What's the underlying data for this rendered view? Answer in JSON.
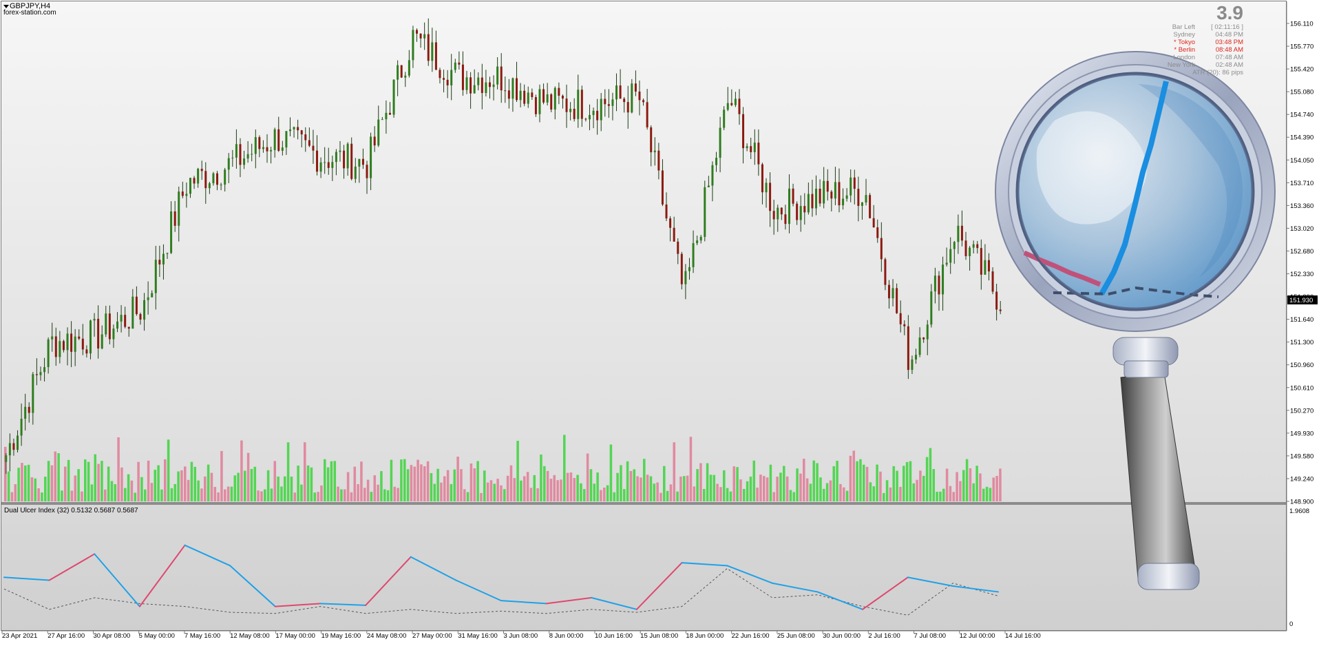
{
  "header": {
    "symbol": "GBPJPY,H4",
    "site": "forex-station.com"
  },
  "info_panel": {
    "spread": "3.9",
    "rows": [
      {
        "label": "Bar Left",
        "value": "[ 02:11:16 ]",
        "highlight": false
      },
      {
        "label": "Sydney",
        "value": "04:48 PM",
        "highlight": false
      },
      {
        "label": "* Tokyo",
        "value": "03:48 PM",
        "highlight": true
      },
      {
        "label": "* Berlin",
        "value": "08:48 AM",
        "highlight": true
      },
      {
        "label": "London",
        "value": "07:48 AM",
        "highlight": false
      },
      {
        "label": "New York",
        "value": "02:48 AM",
        "highlight": false
      }
    ],
    "atr": "ATR (20): 86 pips"
  },
  "price_axis": {
    "labels": [
      "156.110",
      "155.770",
      "155.420",
      "155.080",
      "154.740",
      "154.390",
      "154.050",
      "153.710",
      "153.360",
      "153.020",
      "152.680",
      "152.330",
      "151.990",
      "151.640",
      "151.300",
      "150.960",
      "150.610",
      "150.270",
      "149.930",
      "149.580",
      "149.240",
      "148.900"
    ],
    "current_price": "151.930"
  },
  "indicator": {
    "label": "Dual Ulcer Index (32) 0.5132 0.5687 0.5687",
    "axis_top": "1.9608",
    "axis_bottom": "0"
  },
  "time_axis": {
    "labels": [
      "23 Apr 2021",
      "27 Apr 16:00",
      "30 Apr 08:00",
      "5 May 00:00",
      "7 May 16:00",
      "12 May 08:00",
      "17 May 00:00",
      "19 May 16:00",
      "24 May 08:00",
      "27 May 00:00",
      "31 May 16:00",
      "3 Jun 08:00",
      "8 Jun 00:00",
      "10 Jun 16:00",
      "15 Jun 08:00",
      "18 Jun 00:00",
      "22 Jun 16:00",
      "25 Jun 08:00",
      "30 Jun 00:00",
      "2 Jul 16:00",
      "7 Jul 08:00",
      "12 Jul 00:00",
      "14 Jul 16:00"
    ]
  },
  "chart_data": [
    {
      "type": "candlestick",
      "title": "GBPJPY,H4",
      "ylim": [
        148.9,
        156.11
      ],
      "up_color": "#2e7d1e",
      "down_color": "#8b1a10",
      "key_closes": [
        [
          "23 Apr 2021",
          149.6
        ],
        [
          "27 Apr 16:00",
          151.3
        ],
        [
          "30 Apr 08:00",
          151.4
        ],
        [
          "5 May 00:00",
          151.8
        ],
        [
          "7 May 16:00",
          153.7
        ],
        [
          "12 May 08:00",
          154.0
        ],
        [
          "17 May 00:00",
          154.4
        ],
        [
          "19 May 16:00",
          154.1
        ],
        [
          "24 May 08:00",
          154.0
        ],
        [
          "27 May 00:00",
          155.9
        ],
        [
          "31 May 16:00",
          155.3
        ],
        [
          "3 Jun 08:00",
          155.3
        ],
        [
          "8 Jun 00:00",
          154.9
        ],
        [
          "10 Jun 16:00",
          154.9
        ],
        [
          "15 Jun 08:00",
          155.0
        ],
        [
          "18 Jun 00:00",
          152.0
        ],
        [
          "22 Jun 16:00",
          155.0
        ],
        [
          "25 Jun 08:00",
          153.3
        ],
        [
          "30 Jun 00:00",
          153.5
        ],
        [
          "2 Jul 16:00",
          153.6
        ],
        [
          "7 Jul 08:00",
          151.0
        ],
        [
          "12 Jul 00:00",
          153.0
        ],
        [
          "14 Jul 16:00",
          151.93
        ]
      ]
    },
    {
      "type": "bar",
      "title": "Volume",
      "up_color": "#3cd43c",
      "down_color": "#e07b95"
    },
    {
      "type": "line",
      "title": "Dual Ulcer Index (32) 0.5132 0.5687 0.5687",
      "ylim": [
        0,
        1.9608
      ],
      "colors": {
        "rising": "#e0476f",
        "falling": "#1ea1e8",
        "signal": "#555555"
      },
      "categories": [
        "23 Apr 2021",
        "27 Apr 16:00",
        "30 Apr 08:00",
        "5 May 00:00",
        "7 May 16:00",
        "12 May 08:00",
        "17 May 00:00",
        "19 May 16:00",
        "24 May 08:00",
        "27 May 00:00",
        "31 May 16:00",
        "3 Jun 08:00",
        "8 Jun 00:00",
        "10 Jun 16:00",
        "15 Jun 08:00",
        "18 Jun 00:00",
        "22 Jun 16:00",
        "25 Jun 08:00",
        "30 Jun 00:00",
        "2 Jul 16:00",
        "7 Jul 08:00",
        "12 Jul 00:00",
        "14 Jul 16:00"
      ],
      "series": [
        {
          "values": [
            0.8,
            0.75,
            1.2,
            0.3,
            1.35,
            1.0,
            0.3,
            0.35,
            0.32,
            1.15,
            0.75,
            0.4,
            0.35,
            0.45,
            0.25,
            1.05,
            1.0,
            0.7,
            0.55,
            0.25,
            0.8,
            0.65,
            0.55
          ]
        },
        {
          "values": [
            0.6,
            0.25,
            0.45,
            0.35,
            0.3,
            0.2,
            0.18,
            0.3,
            0.18,
            0.25,
            0.18,
            0.22,
            0.18,
            0.25,
            0.2,
            0.3,
            0.95,
            0.45,
            0.5,
            0.3,
            0.15,
            0.7,
            0.48
          ]
        }
      ]
    }
  ],
  "magnifier": {
    "lens_color": "#6fa5cf",
    "ring_color": "#b9c2d6",
    "handle_color": "#6d6d6d"
  }
}
